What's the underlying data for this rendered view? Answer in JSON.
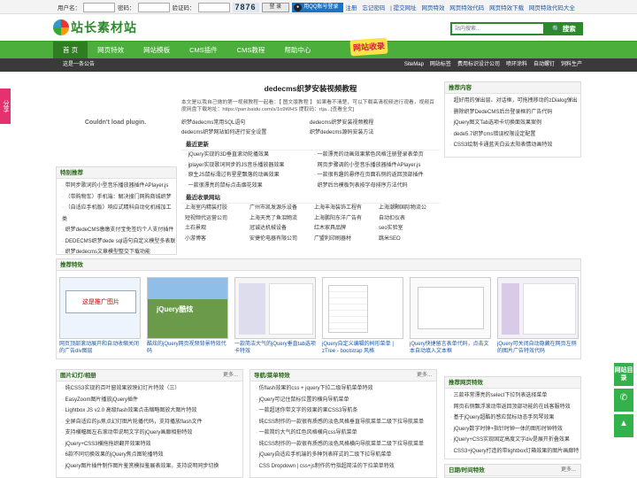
{
  "topbar": {
    "username_label": "用户名：",
    "password_label": "密码：",
    "captcha_label": "验证码：",
    "captcha_value": "7876",
    "login_button": "登 录",
    "qq_login": "用QQ账号登录",
    "links": [
      "注册",
      "忘记密码",
      "| 提交网址",
      "网页特效",
      "网页特效代码",
      "网页特效下载",
      "网页特效代码大全"
    ]
  },
  "header": {
    "logo_text": "站长素材站",
    "search_placeholder": "站内搜索...",
    "search_button": "搜索"
  },
  "nav": {
    "items": [
      "首 页",
      "网页特效",
      "网站模板",
      "CMS插件",
      "CMS教程",
      "帮助中心"
    ],
    "badge": "网站收录"
  },
  "subnav": {
    "left": "这是一条公告",
    "right": [
      "SiteMap",
      "网站标签",
      "费用标识设计公司",
      "喷环涂料",
      "自动螺钉",
      "饲料生产"
    ]
  },
  "share_tab": "分享",
  "plugin_message": "Couldn't load plugin.",
  "article": {
    "title": "dedecms织梦安装视频教程",
    "summary": "本文是以我自己做的第一视频教程一起看：【 图文版教程 】 如果看不清楚，可以下载高清视频进行观看，视频百度网盘下载地址：https://pan.baidu.com/s/1o9WHS 提取码：rtja...[查看全文]",
    "links": [
      "织梦dedecms常用SQL语句",
      "dedecms织梦安装视频教程",
      "dedecms织梦网站如何进行安全设置",
      "织梦dedecms源码安装方法"
    ],
    "recent_title": "最近更新",
    "recent": [
      "jQuery实现的3D垂直滚动轮播效果",
      "一款漂亮的动画效果紫色风格注册登录表单页",
      "jplayer实现歌词同步的JS音乐播放器效果",
      "网页步骤调的小型音乐播放器插件APlayer.js",
      "原生JS鼠标滑过有星星飘落的动画效果",
      "一款很有趣的悬停在页面右侧的返回顶部插件",
      "一款很漂亮的鼠标点击烟花效果",
      "织梦后台模板列表按字母排序方法代码"
    ],
    "friend_title": "最近收录网站",
    "friends": [
      "上海室内精装打胶",
      "广州市凯发源乐设备",
      "上海丰海装饰工程有",
      "上海潮颗国际物流公",
      "短视频代运营公司",
      "上海天亮了鱼泪物流",
      "上海鹏阳东洋广告有",
      "自动扣仪表",
      "土石景观",
      "冠诚达机械设备",
      "红木家具品牌",
      "seo实验室",
      "小游博客",
      "安捷伦电器有限公司",
      "广盟利印刷器材",
      "跳米SEO"
    ]
  },
  "recommend_content": {
    "title": "推荐内容",
    "items": [
      "超好用的弹出层、对话框，可拖拽移动的zDialog弹出",
      "删除织梦DedeCMS后台登录框的广告代码",
      "jQuery图文Tab选项卡切换面效果案例",
      "dede5.7织梦cms错误权限设定配置",
      "CSS3绘制卡通蓝天白云太阳表情动画特效"
    ]
  },
  "special": {
    "title": "特别推荐",
    "items": [
      "带同步歌词的小型音乐播放器插件APlayer.js",
      "（带购物车）手机端：解决搜门网购商城织梦",
      "（自适应手机版）响应式精科自动化机械加工类",
      "织梦dedeCMS缴缴支付宝免签约个人支付插件",
      "DEDECMS织梦dede sql语句自定义模型多表联",
      "织梦dedecms文章模型整交下载功能"
    ]
  },
  "recommend_effects": {
    "title": "推荐特效",
    "cards": [
      {
        "caption": "网页顶部滚动展开和自动收缩关闭的广告div图层",
        "thumb_text": "这是推广图片"
      },
      {
        "caption": "酷炫的jQuery网页视频背景特效代码",
        "thumb_text": "jQuery酷炫"
      },
      {
        "caption": "一款简洁大气的jQuery垂直tab选项卡特效",
        "thumb_text": ""
      },
      {
        "caption": "jQuery自定义编辑的树形菜单 | zTree - bootstrap 风格",
        "thumb_text": ""
      },
      {
        "caption": "jQuery快捷留言表单代码，点击文本自动填入文本框",
        "thumb_text": ""
      },
      {
        "caption": "jQuery可关闭自动隐藏在网页左侧的图片广告特效代码",
        "thumb_text": ""
      }
    ]
  },
  "image_box": {
    "title": "图片幻灯/相册",
    "more": "更多...",
    "items": [
      "纯CSS3实现的百叶窗效果放映幻灯片特效（三）",
      "EasyZoom图片播放jQuery插件",
      "Lightbox JS v2.0 高级flash效果点击缩略图放大图片特效",
      "全屏自适应的js焦点幻灯图片轮播代码，支持播放flash文件",
      "支持横幅图左右滚动带说明文字的jQuery画廊相册特效",
      "jQuery+CSS3横拖拖织翻开效果特效",
      "6款不同切换效果的jQuery焦点图轮播特效",
      "jQuery图片插件制作图片鉴赏模拟鉴展表效果，支持说明同步切换"
    ]
  },
  "nav_box": {
    "title": "导航/菜单特效",
    "more": "更多...",
    "items": [
      "仿flash效果的css + jquery下拉二级导航菜单特效",
      "jQuery可记住鼠标位置的横向导航菜单",
      "一款超迷你带文字的效果的果CSS3导航条",
      "纯CSS制作的一款很有质感的淡色风格垂直导航菜单二级下拉导航菜单",
      "一款简约大气的红色风格横向css导航菜单",
      "纯CSS制作的一款很有质感的淡色风格横向导航菜单二级下拉导航菜单",
      "jQuery自适应手机端的多种列表样式的二级下拉导航菜单",
      "CSS Dropdown | css+js制作的竹指超简洁的下拉菜单特效"
    ]
  },
  "effects_box": {
    "title": "推荐网页特效",
    "items": [
      "三款非常漂亮的select下拉列表选择菜单",
      "网页右侧飘浮滚动带返回顶部功能的在线客服特效",
      "基于jQuery超酷的感应鼠标动态手风琴效果",
      "jQuery数字时钟+指针时钟一体的图形时钟特效",
      "jQuery+CSS实现固定高度文字div是展开折叠效果",
      "CSS3+jQuery打造的带lightbox灯箱效果的图片画廊特"
    ]
  },
  "date_box": {
    "title": "日期/时间特效",
    "more": "更多..."
  },
  "side_tabs": [
    "网站目录",
    "微信"
  ]
}
